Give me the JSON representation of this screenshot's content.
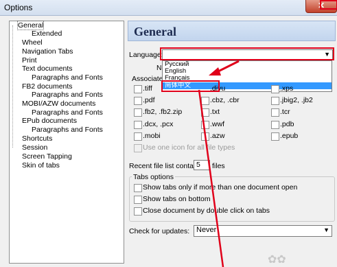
{
  "window": {
    "title": "Options",
    "close_label": "✕"
  },
  "tree": {
    "items": [
      {
        "label": "General",
        "level": 0
      },
      {
        "label": "Extended",
        "level": 1
      },
      {
        "label": "Wheel",
        "level": 0
      },
      {
        "label": "Navigation Tabs",
        "level": 0
      },
      {
        "label": "Print",
        "level": 0
      },
      {
        "label": "Text documents",
        "level": 0
      },
      {
        "label": "Paragraphs and Fonts",
        "level": 1
      },
      {
        "label": "FB2 documents",
        "level": 0
      },
      {
        "label": "Paragraphs and Fonts",
        "level": 1
      },
      {
        "label": "MOBI/AZW documents",
        "level": 0
      },
      {
        "label": "Paragraphs and Fonts",
        "level": 1
      },
      {
        "label": "EPub documents",
        "level": 0
      },
      {
        "label": "Paragraphs and Fonts",
        "level": 1
      },
      {
        "label": "Shortcuts",
        "level": 0
      },
      {
        "label": "Session",
        "level": 0
      },
      {
        "label": "Screen Tapping",
        "level": 0
      },
      {
        "label": "Skin of tabs",
        "level": 0
      }
    ]
  },
  "panel": {
    "header": "General",
    "language_label": "Language:",
    "language_value": "",
    "language_options": [
      "Русский",
      "English",
      "Français",
      "简体中文"
    ],
    "no_label": "No",
    "associated_label": "Associated",
    "filetypes": [
      [
        ".tiff",
        ".djvu",
        ".xps"
      ],
      [
        ".pdf",
        ".cbz, .cbr",
        ".jbig2, .jb2"
      ],
      [
        ".fb2, .fb2.zip",
        ".txt",
        ".tcr"
      ],
      [
        ".dcx, .pcx",
        ".wwf",
        ".pdb"
      ],
      [
        ".mobi",
        ".azw",
        ".epub"
      ]
    ],
    "one_icon_label": "Use one icon for all file types",
    "recent_label": "Recent file list contains:",
    "recent_value": "5",
    "recent_unit": "files",
    "tabs_options_label": "Tabs options",
    "tabs_options": [
      "Show tabs only if more than one document open",
      "Show tabs on bottom",
      "Close document by double click on tabs"
    ],
    "updates_label": "Check for updates:",
    "updates_value": "Never"
  },
  "colors": {
    "annotation_red": "#e0001a",
    "highlight": "#3399ff",
    "header_text": "#1d2b50"
  }
}
